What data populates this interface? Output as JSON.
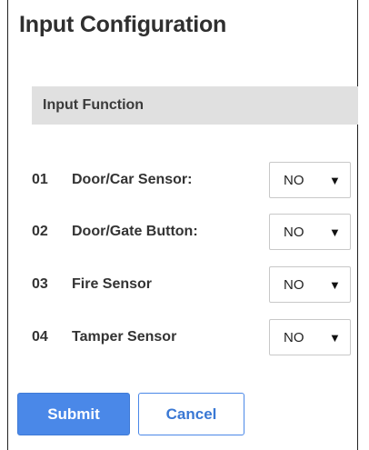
{
  "page": {
    "title": "Input Configuration"
  },
  "section": {
    "title": "Input Function"
  },
  "inputs": [
    {
      "number": "01",
      "label": "Door/Car Sensor:",
      "value": "NO"
    },
    {
      "number": "02",
      "label": "Door/Gate Button:",
      "value": "NO"
    },
    {
      "number": "03",
      "label": "Fire Sensor",
      "value": "NO"
    },
    {
      "number": "04",
      "label": "Tamper Sensor",
      "value": "NO"
    }
  ],
  "select": {
    "arrow_glyph": "▼"
  },
  "buttons": {
    "submit": "Submit",
    "cancel": "Cancel"
  },
  "colors": {
    "accent": "#4a88e8",
    "section_bg": "#e0e0e0",
    "text": "#333333"
  }
}
